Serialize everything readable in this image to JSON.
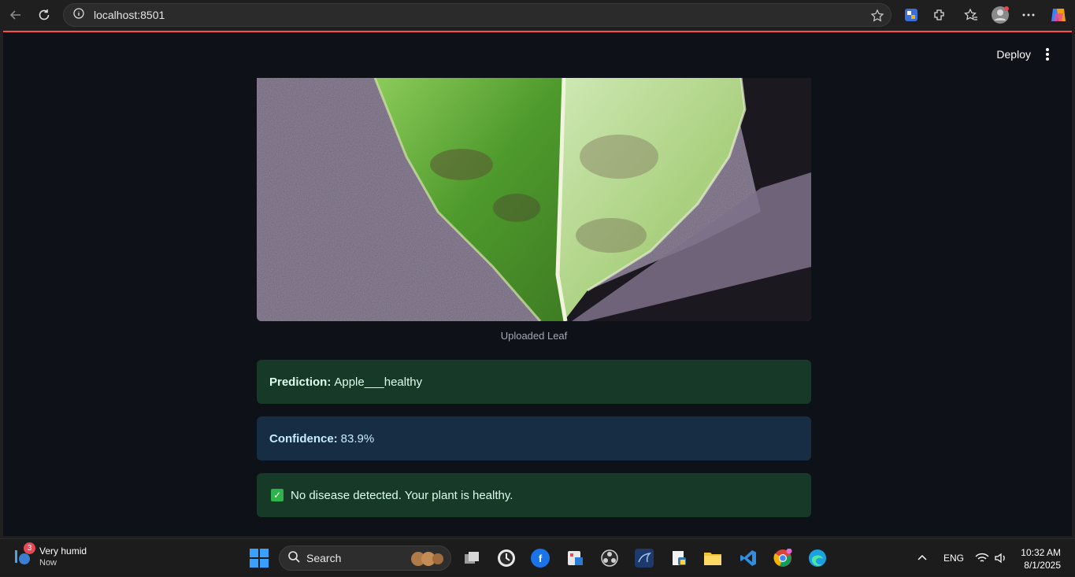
{
  "browser": {
    "url": "localhost:8501",
    "icons": [
      "back-icon",
      "refresh-icon",
      "info-icon",
      "favorite-star-icon",
      "extensions-icon",
      "favorites-icon",
      "profile-icon",
      "more-icon",
      "copilot-icon"
    ]
  },
  "app": {
    "deploy_label": "Deploy",
    "image_caption": "Uploaded Leaf",
    "prediction_label": "Prediction:",
    "prediction_value": "Apple___healthy",
    "confidence_label": "Confidence:",
    "confidence_value": "83.9%",
    "status_message": "No disease detected. Your plant is healthy.",
    "colors": {
      "success_bg": "#173928",
      "info_bg": "#172d43",
      "accent": "#ff4b4b",
      "background": "#0e1117"
    }
  },
  "taskbar": {
    "weather_title": "Very humid",
    "weather_sub": "Now",
    "weather_badge": "3",
    "search_label": "Search",
    "language": "ENG",
    "time": "10:32 AM",
    "date": "8/1/2025"
  }
}
